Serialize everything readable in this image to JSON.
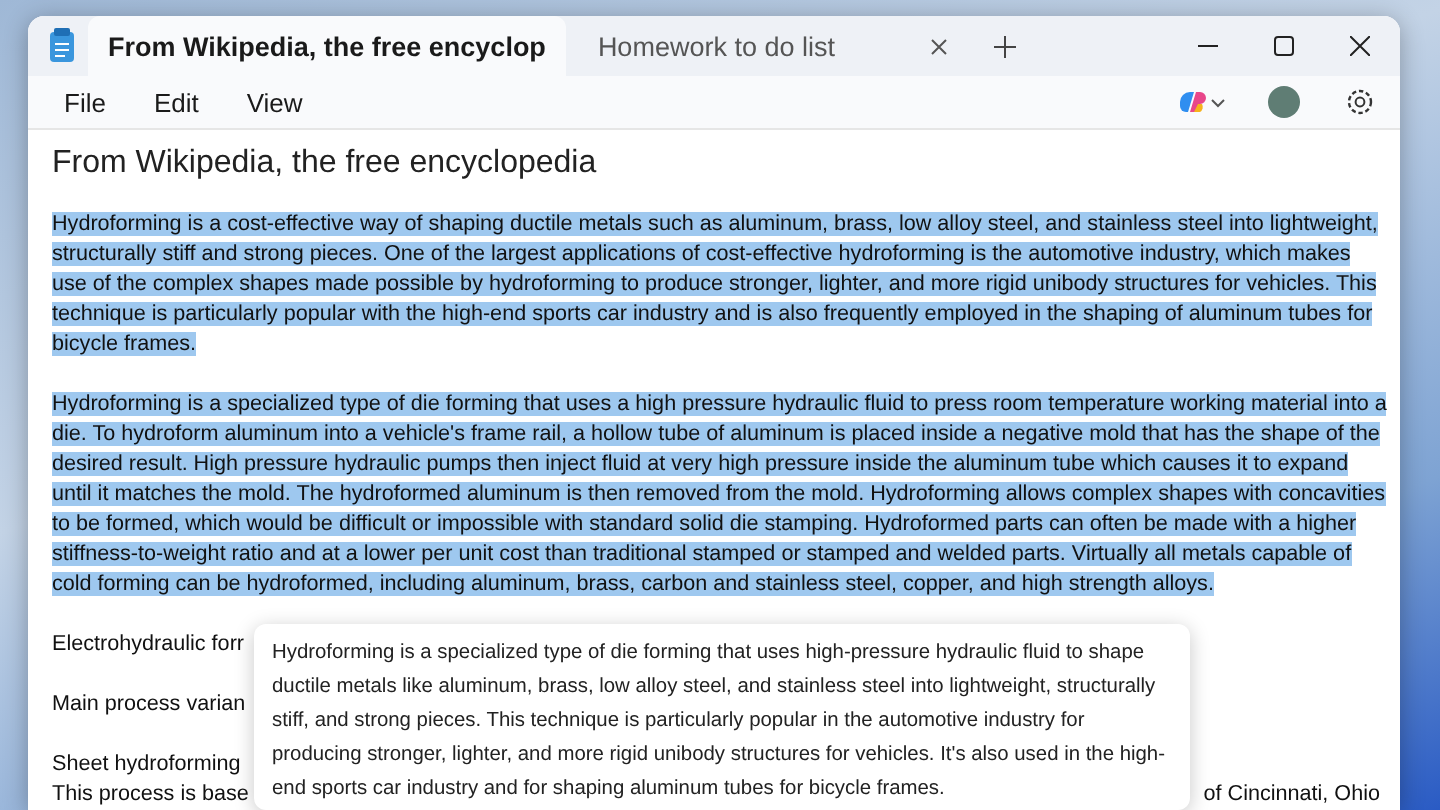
{
  "window": {
    "title_tabs": [
      {
        "label": "From Wikipedia, the free encyclop",
        "selected": true
      },
      {
        "label": "Homework to do list",
        "selected": false
      }
    ]
  },
  "menu": [
    "File",
    "Edit",
    "View"
  ],
  "document": {
    "heading": "From Wikipedia, the free encyclopedia",
    "paragraphs": [
      {
        "selected": true,
        "text": "Hydroforming is a cost-effective way of shaping ductile metals such as aluminum, brass, low alloy steel, and stainless steel into lightweight, structurally stiff and strong pieces. One of the largest applications of cost-effective hydroforming is the automotive industry, which makes use of the complex shapes made possible by hydroforming to produce stronger, lighter, and more rigid unibody structures for vehicles. This technique is particularly popular with the high-end sports car industry and is also frequently employed in the shaping of aluminum tubes for bicycle frames."
      },
      {
        "selected": true,
        "text": "Hydroforming is a specialized type of die forming that uses a high pressure hydraulic fluid to press room temperature working material into a die. To hydroform aluminum into a vehicle's frame rail, a hollow tube of aluminum is placed inside a negative mold that has the shape of the desired result. High pressure hydraulic pumps then inject fluid at very high pressure inside the aluminum tube which causes it to expand until it matches the mold. The hydroformed aluminum is then removed from the mold. Hydroforming allows complex shapes with concavities to be formed, which would be difficult or impossible with standard solid die stamping. Hydroformed parts can often be made with a higher stiffness-to-weight ratio and at a lower per unit cost than traditional stamped or stamped and welded parts. Virtually all metals capable of cold forming can be hydroformed, including aluminum, brass, carbon and stainless steel, copper, and high strength alloys."
      }
    ],
    "partial_paragraphs": [
      {
        "lines": [
          {
            "left": "Electrohydraulic forr"
          }
        ]
      },
      {
        "lines": [
          {
            "left": "Main process varian"
          }
        ]
      },
      {
        "lines": [
          {
            "left": "Sheet hydroforming"
          },
          {
            "left": "This process is base",
            "right": "of Cincinnati, Ohio"
          }
        ]
      }
    ]
  },
  "summary_popup": {
    "text": "Hydroforming is a specialized type of die forming that uses high-pressure hydraulic fluid to shape ductile metals like aluminum, brass, low alloy steel, and stainless steel into lightweight, structurally stiff, and strong pieces. This technique is particularly popular in the automotive industry for producing stronger, lighter, and more rigid unibody structures for vehicles. It's also used in the high-end sports car industry and for shaping aluminum tubes for bicycle frames."
  }
}
